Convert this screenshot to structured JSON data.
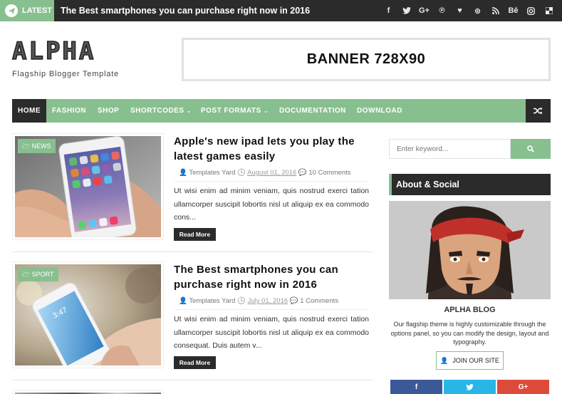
{
  "topbar": {
    "latest_label": "LATEST",
    "ticker_text": "The Best smartphones you can purchase right now in 2016",
    "social_icons": [
      {
        "name": "facebook-icon",
        "glyph": "f"
      },
      {
        "name": "twitter-icon",
        "glyph": "🐦"
      },
      {
        "name": "google-plus-icon",
        "glyph": "G+"
      },
      {
        "name": "pinterest-icon",
        "glyph": "℗"
      },
      {
        "name": "heart-icon",
        "glyph": "♥"
      },
      {
        "name": "dribbble-icon",
        "glyph": "⊛"
      },
      {
        "name": "rss-icon",
        "glyph": ")))"
      },
      {
        "name": "behance-icon",
        "glyph": "Bē"
      },
      {
        "name": "instagram-icon",
        "glyph": "◎"
      },
      {
        "name": "delicious-icon",
        "glyph": "▟"
      }
    ]
  },
  "header": {
    "logo": "ALPHA",
    "tagline": "Flagship Blogger Template",
    "banner_text": "BANNER 728X90"
  },
  "nav": {
    "items": [
      {
        "label": "HOME",
        "active": true
      },
      {
        "label": "FASHION"
      },
      {
        "label": "SHOP"
      },
      {
        "label": "SHORTCODES",
        "dropdown": true
      },
      {
        "label": "POST FORMATS",
        "dropdown": true
      },
      {
        "label": "DOCUMENTATION"
      },
      {
        "label": "DOWNLOAD"
      }
    ]
  },
  "posts": [
    {
      "tag": "NEWS",
      "title": "Apple's new ipad lets you play the latest games easily",
      "author": "Templates Yard",
      "date": "August 01, 2016",
      "comments": "10 Comments",
      "excerpt": "Ut wisi enim ad minim veniam, quis nostrud exerci tation ullamcorper suscipit lobortis nisl ut aliquip ex ea commodo cons...",
      "read_more": "Read More"
    },
    {
      "tag": "SPORT",
      "title": "The Best smartphones you can purchase right now in 2016",
      "author": "Templates Yard",
      "date": "July 01, 2016",
      "comments": "1 Comments",
      "excerpt": "Ut wisi enim ad minim veniam, quis nostrud exerci tation ullamcorper suscipit lobortis nisl ut aliquip ex ea commodo consequat. Duis autem v...",
      "read_more": "Read More"
    }
  ],
  "sidebar": {
    "search_placeholder": "Enter keyword...",
    "widget_title": "About & Social",
    "blog_name": "APLHA BLOG",
    "blog_description": "Our flagship theme is highly customizable through the options panel, so you can modify the design, layout and typography.",
    "join_label": "JOIN OUR SITE",
    "social_buttons": [
      {
        "label": "f",
        "color": "#3b5998"
      },
      {
        "label": "🐦",
        "color": "#29b6e6"
      },
      {
        "label": "G+",
        "color": "#dd4b39"
      }
    ]
  },
  "colors": {
    "accent": "#88bf8f",
    "dark": "#2b2b2b"
  }
}
